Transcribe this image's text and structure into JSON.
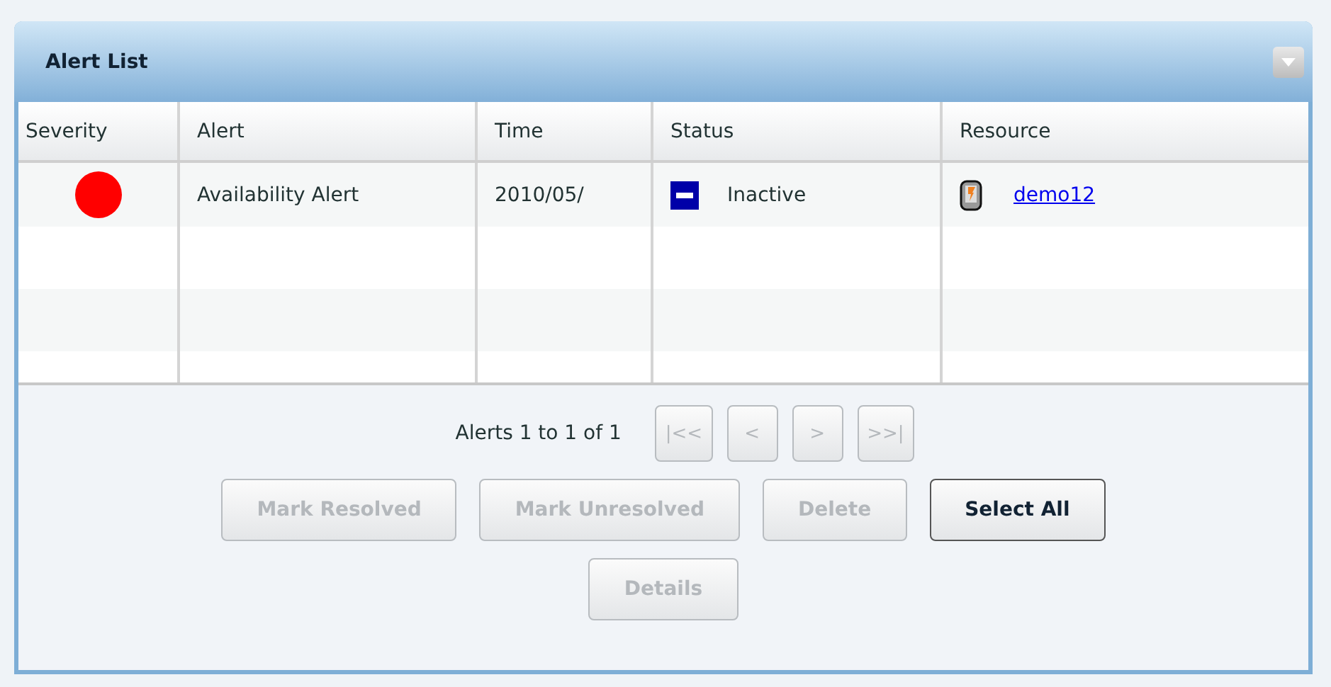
{
  "panel": {
    "title": "Alert List"
  },
  "table": {
    "columns": [
      "Severity",
      "Alert",
      "Time",
      "Status",
      "Resource"
    ],
    "rows": [
      {
        "color": "#ff0000",
        "alert": "Availability Alert",
        "time": "2010/05/",
        "status": {
          "kind": "inactive",
          "label": "Inactive"
        },
        "resource": "demo12"
      }
    ]
  },
  "pagination": {
    "summary": "Alerts 1 to 1 of 1",
    "buttons": [
      {
        "label": "|<<",
        "disabled": true
      },
      {
        "label": "<",
        "disabled": true
      },
      {
        "label": ">",
        "disabled": true
      },
      {
        "label": ">>|",
        "disabled": true
      }
    ]
  },
  "actions": [
    {
      "label": "Mark Resolved",
      "disabled": true
    },
    {
      "label": "Mark Unresolved",
      "disabled": true
    },
    {
      "label": "Delete",
      "disabled": true
    },
    {
      "label": "Select All",
      "disabled": false
    },
    {
      "label": "Details",
      "disabled": true
    }
  ]
}
